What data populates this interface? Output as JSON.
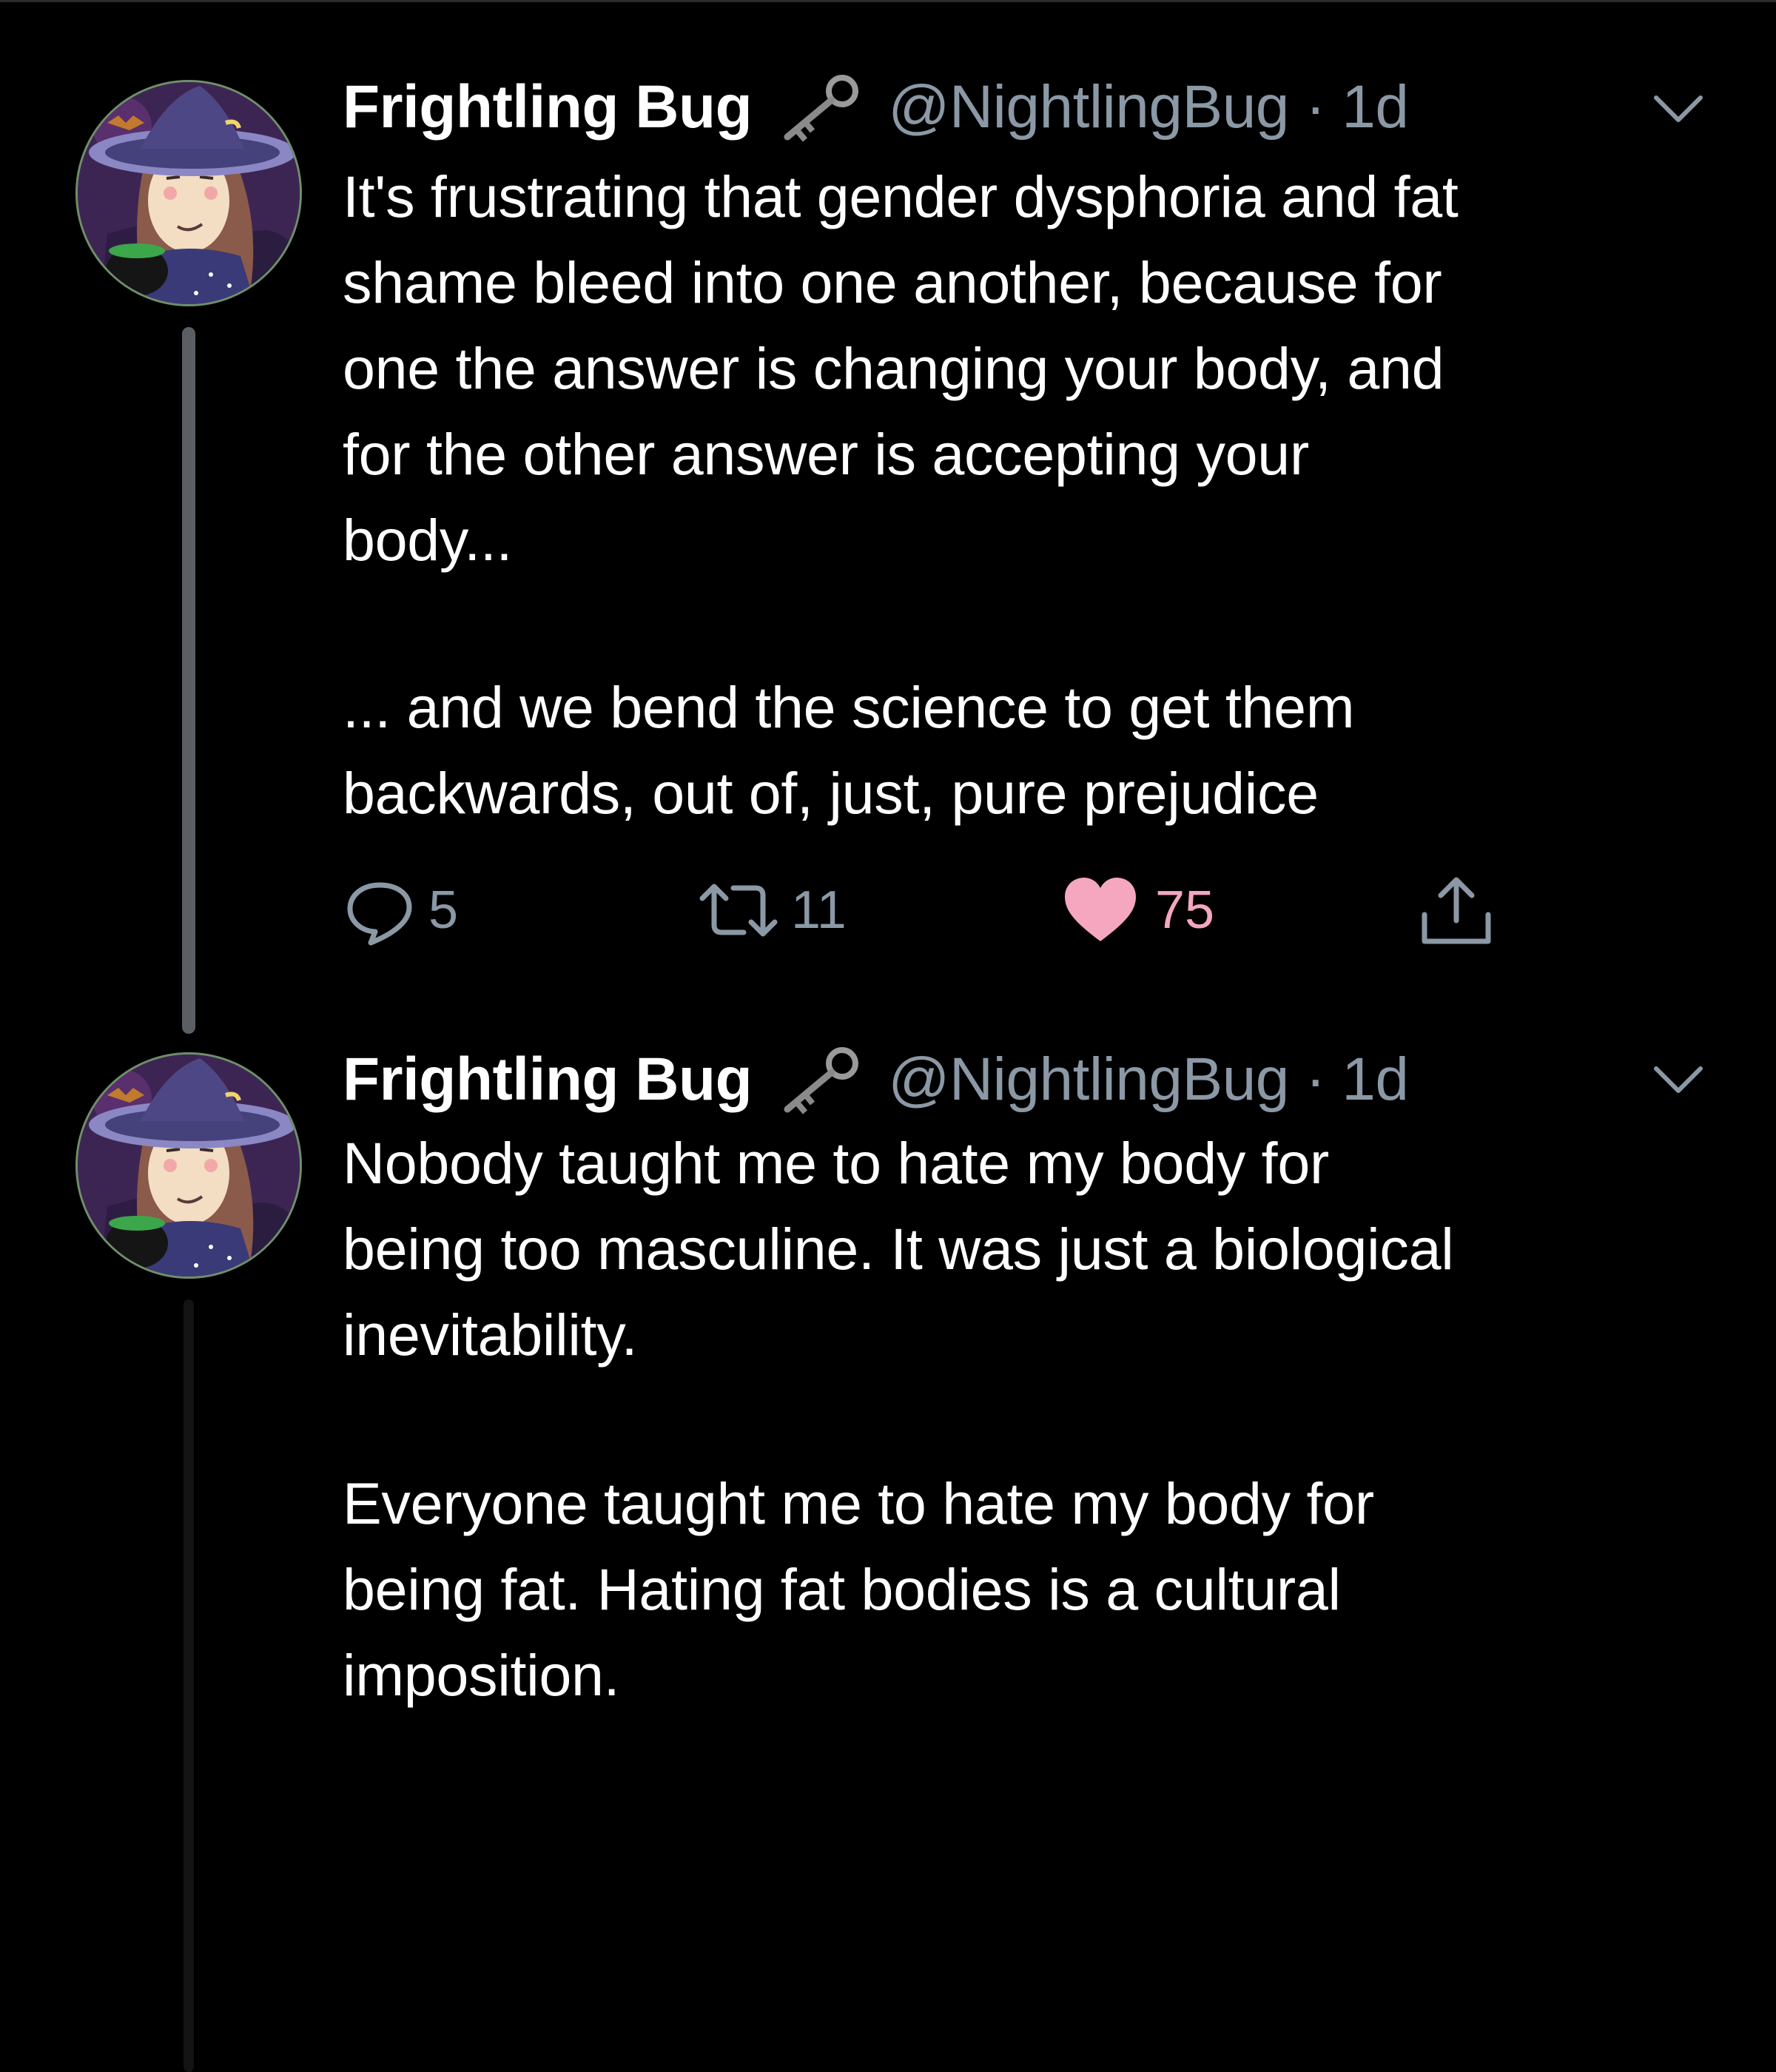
{
  "tweets": [
    {
      "author": {
        "display_name": "Frightling Bug",
        "handle_time": "@NightlingBug · 1d"
      },
      "text": {
        "paragraph_1": "It's frustrating that gender dysphoria and fat\nshame bleed into one another, because for\none the answer is changing your body, and\nfor the other answer is accepting your\nbody...",
        "paragraph_2": "... and we bend the science to get them\nbackwards, out of, just, pure prejudice"
      },
      "stats": {
        "replies": "5",
        "retweets": "11",
        "likes": "75"
      },
      "liked": true
    },
    {
      "author": {
        "display_name": "Frightling Bug",
        "handle_time": "@NightlingBug · 1d"
      },
      "text": {
        "paragraph_1": "Nobody taught me to hate my body for\nbeing too masculine. It was just a biological\ninevitability.",
        "paragraph_2": "Everyone taught me to hate my body for\nbeing fat. Hating fat bodies is a cultural\nimposition."
      }
    }
  ],
  "icons": {
    "verified_emoji": "old-key-icon",
    "menu": "chevron-down-icon",
    "reply": "reply-bubble-icon",
    "retweet": "retweet-icon",
    "like": "heart-icon",
    "share": "share-icon"
  },
  "colors": {
    "background": "#000000",
    "text_primary": "#ffffff",
    "text_secondary": "#8b98a5",
    "like_active": "#f4a7bf",
    "thread_line": "#5b5f64"
  }
}
